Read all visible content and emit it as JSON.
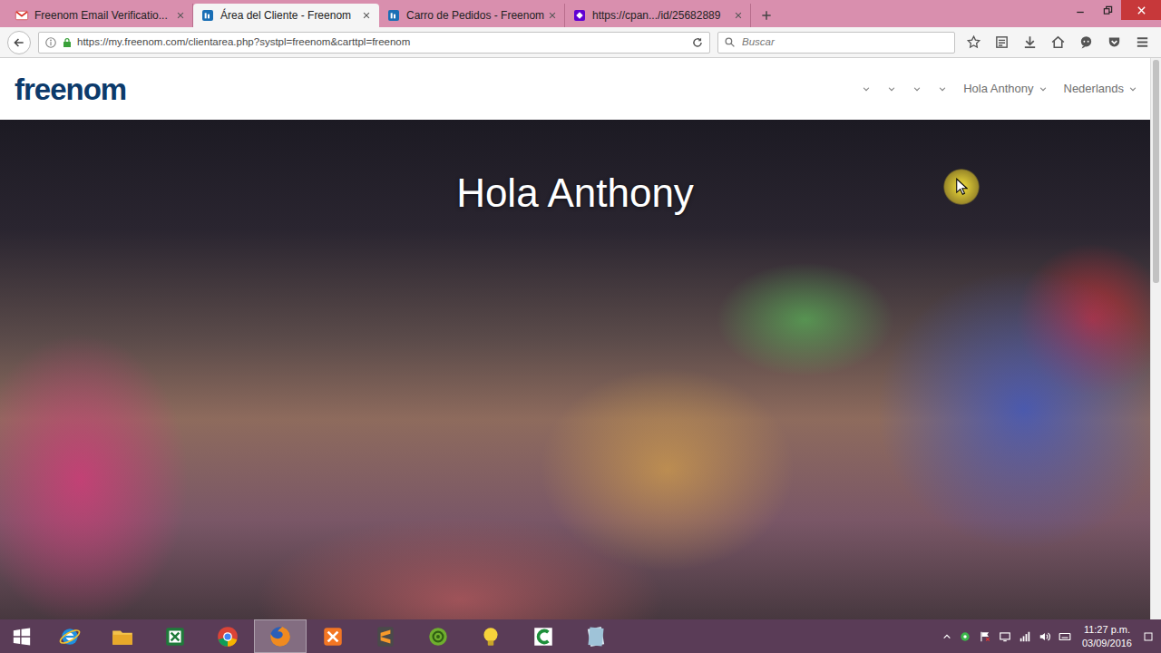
{
  "browser": {
    "tabs": [
      {
        "label": "Freenom Email Verificatio...",
        "selected": false,
        "kind": "gmail"
      },
      {
        "label": "Área del Cliente - Freenom",
        "selected": true,
        "kind": "freenom"
      },
      {
        "label": "Carro de Pedidos - Freenom",
        "selected": false,
        "kind": "freenom"
      },
      {
        "label": "https://cpan.../id/25682889",
        "selected": false,
        "kind": "yahoo"
      }
    ],
    "address": "https://my.freenom.com/clientarea.php?systpl=freenom&carttpl=freenom",
    "search": {
      "placeholder": "Buscar"
    }
  },
  "page": {
    "logo": "freenom",
    "nav": {
      "user": "Hola Anthony",
      "language": "Nederlands"
    },
    "hero": {
      "title": "Hola Anthony"
    }
  },
  "taskbar": {
    "apps": [
      {
        "kind": "ie",
        "selected": false
      },
      {
        "kind": "explorer",
        "selected": false
      },
      {
        "kind": "excel",
        "selected": false
      },
      {
        "kind": "chrome",
        "selected": false
      },
      {
        "kind": "firefox",
        "selected": true
      },
      {
        "kind": "xampp",
        "selected": false
      },
      {
        "kind": "sublime",
        "selected": false
      },
      {
        "kind": "spiral",
        "selected": false
      },
      {
        "kind": "bulb",
        "selected": false
      },
      {
        "kind": "camtasia",
        "selected": false
      },
      {
        "kind": "notes",
        "selected": false
      }
    ],
    "clock": {
      "time": "11:27 p.m.",
      "date": "03/09/2016"
    }
  }
}
